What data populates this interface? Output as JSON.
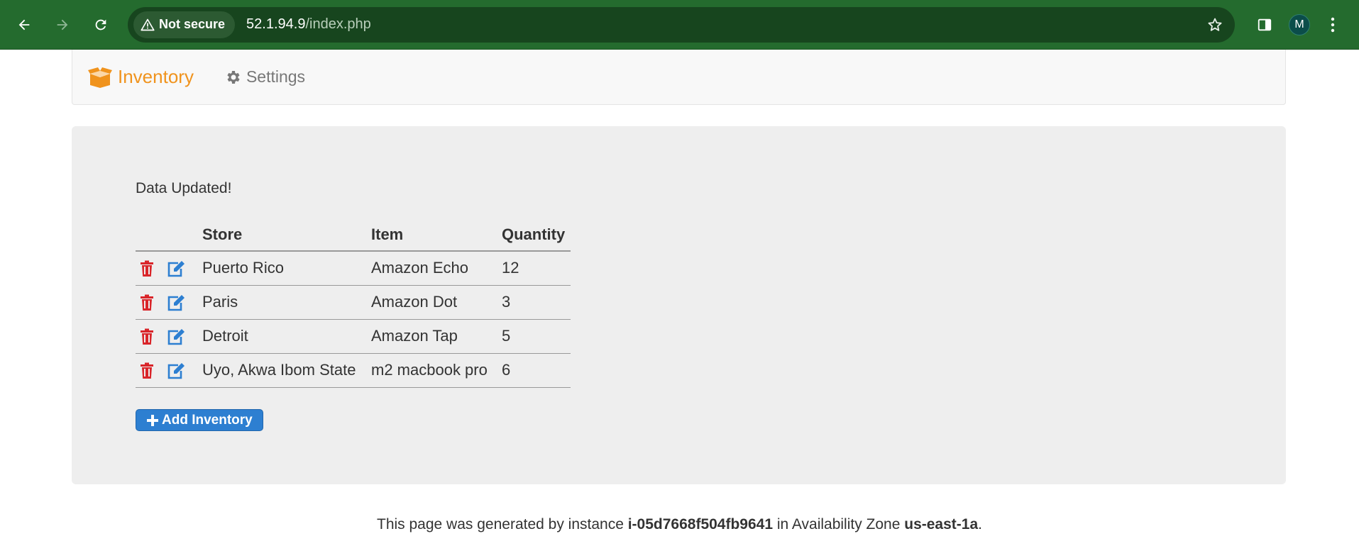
{
  "browser": {
    "security_label": "Not secure",
    "url_host": "52.1.94.9",
    "url_path": "/index.php",
    "profile_initial": "M"
  },
  "navbar": {
    "brand_label": "Inventory",
    "brand_color": "#f0931d",
    "settings_label": "Settings"
  },
  "main": {
    "status_message": "Data Updated!",
    "table": {
      "headers": [
        "Store",
        "Item",
        "Quantity"
      ],
      "rows": [
        {
          "store": "Puerto Rico",
          "item": "Amazon Echo",
          "quantity": "12"
        },
        {
          "store": "Paris",
          "item": "Amazon Dot",
          "quantity": "3"
        },
        {
          "store": "Detroit",
          "item": "Amazon Tap",
          "quantity": "5"
        },
        {
          "store": "Uyo, Akwa Ibom State",
          "item": "m2 macbook pro",
          "quantity": "6"
        }
      ]
    },
    "add_button_label": "Add Inventory"
  },
  "footer": {
    "prefix": "This page was generated by instance ",
    "instance_id": "i-05d7668f504fb9641",
    "middle": " in Availability Zone ",
    "zone": "us-east-1a",
    "suffix": "."
  },
  "colors": {
    "delete_icon": "#d9252a",
    "edit_icon": "#2d7fd1",
    "chrome_bg": "#246b2e"
  }
}
